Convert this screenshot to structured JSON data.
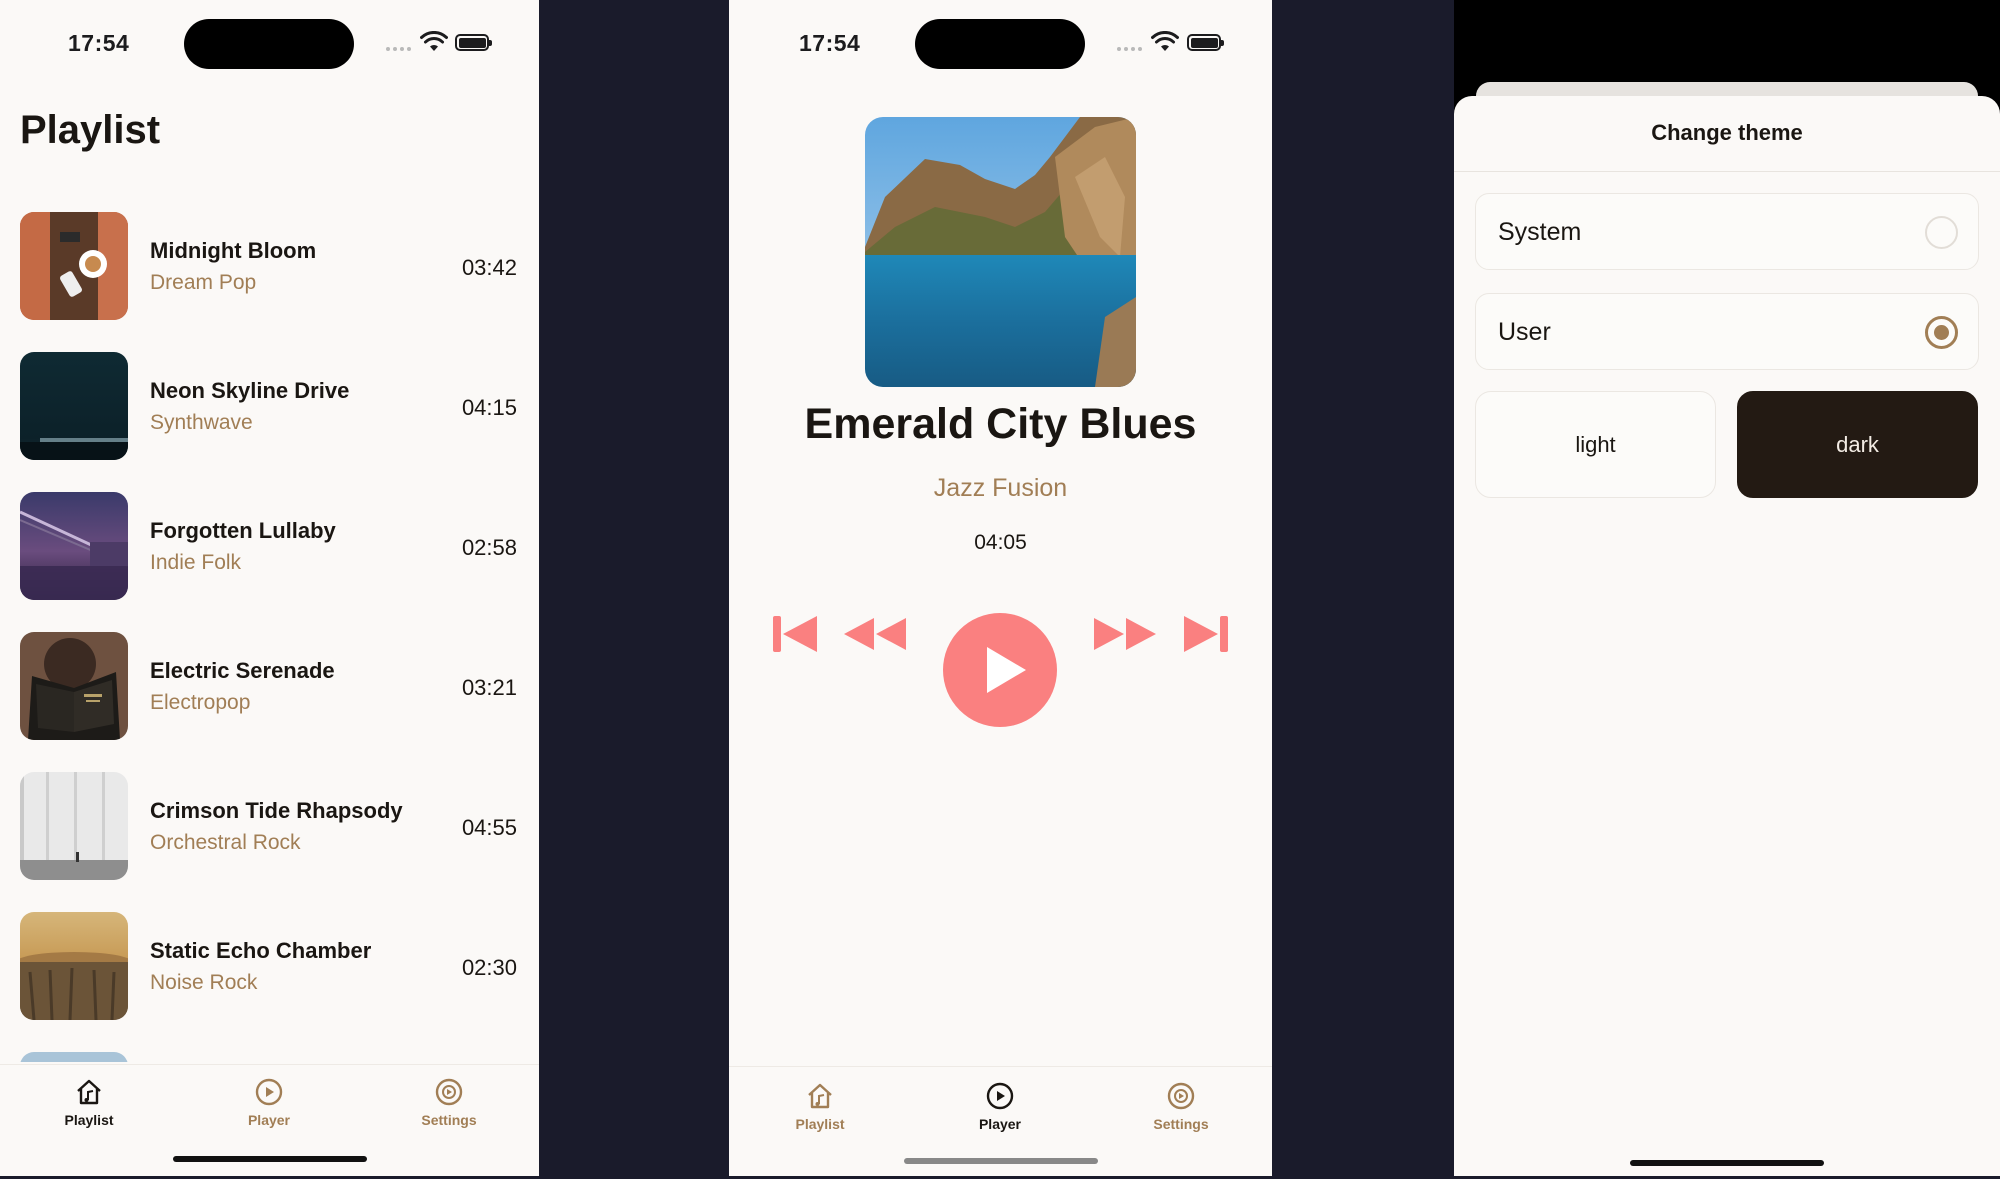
{
  "colors": {
    "accent_brown": "#a17e55",
    "play_coral": "#fa8080",
    "background": "#fbf9f7",
    "text": "#1a1612",
    "dark_theme": "#231a13",
    "gutter": "#1a1b2b"
  },
  "status": {
    "time_left": "17:54",
    "time_middle": "17:54"
  },
  "playlist": {
    "title": "Playlist",
    "tracks": [
      {
        "title": "Midnight Bloom",
        "genre": "Dream Pop",
        "duration": "03:42",
        "art": "coffee-table-photo"
      },
      {
        "title": "Neon Skyline Drive",
        "genre": "Synthwave",
        "duration": "04:15",
        "art": "night-sky-photo"
      },
      {
        "title": "Forgotten Lullaby",
        "genre": "Indie Folk",
        "duration": "02:58",
        "art": "bridge-at-night-photo"
      },
      {
        "title": "Electric Serenade",
        "genre": "Electropop",
        "duration": "03:21",
        "art": "person-reading-book-photo"
      },
      {
        "title": "Crimson Tide Rhapsody",
        "genre": "Orchestral Rock",
        "duration": "04:55",
        "art": "grey-columns-photo"
      },
      {
        "title": "Static Echo Chamber",
        "genre": "Noise Rock",
        "duration": "02:30",
        "art": "tree-stump-sunset-photo"
      }
    ]
  },
  "player": {
    "title": "Emerald City Blues",
    "genre": "Jazz Fusion",
    "duration": "04:05",
    "art": "sea-cliffs-photo",
    "controls": [
      "skip-back-icon",
      "rewind-icon",
      "play-icon",
      "fast-forward-icon",
      "skip-forward-icon"
    ]
  },
  "tabs": {
    "playlist": "Playlist",
    "player": "Player",
    "settings": "Settings"
  },
  "settings": {
    "sheet_title": "Change theme",
    "options": [
      {
        "label": "System",
        "selected": false
      },
      {
        "label": "User",
        "selected": true
      }
    ],
    "theme_light": "light",
    "theme_dark": "dark"
  }
}
